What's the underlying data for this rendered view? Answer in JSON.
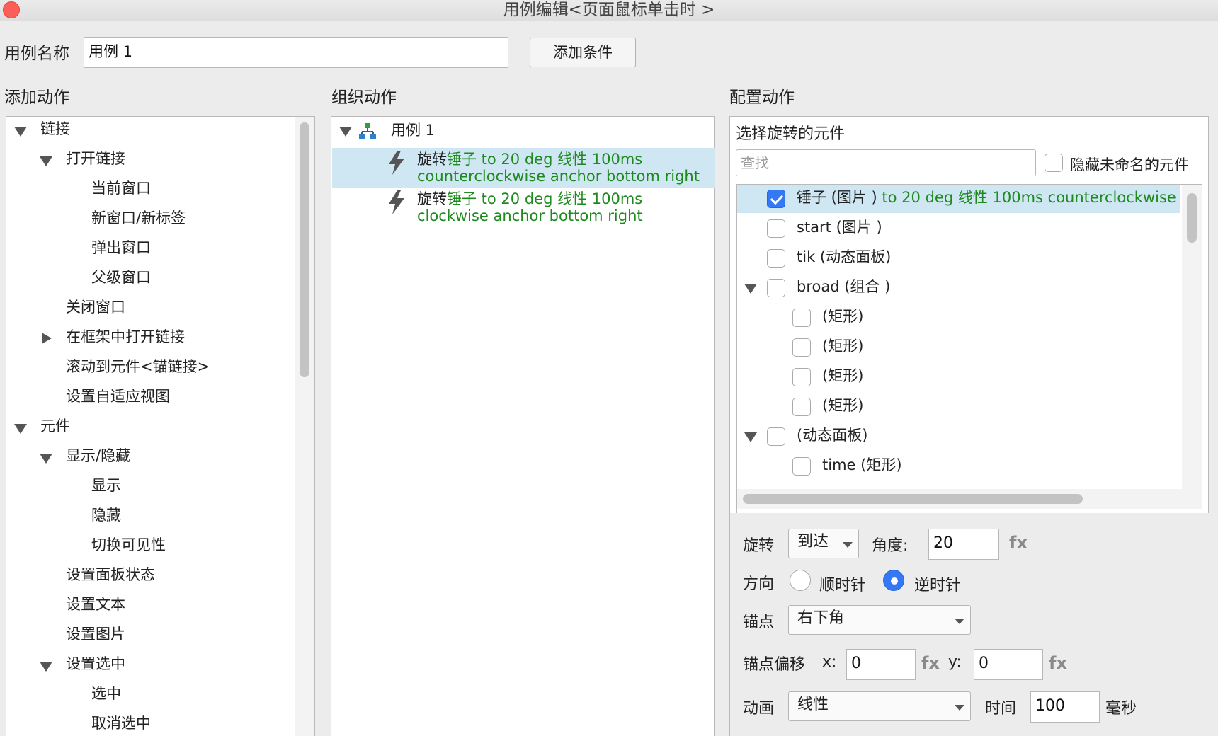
{
  "window": {
    "title": "用例编辑<页面鼠标单击时 >"
  },
  "case_name": {
    "label": "用例名称",
    "value": "用例 1",
    "add_condition": "添加条件"
  },
  "add_actions": {
    "heading": "添加动作",
    "items": [
      {
        "label": "链接"
      },
      {
        "label": "打开链接"
      },
      {
        "label": "当前窗口"
      },
      {
        "label": "新窗口/新标签"
      },
      {
        "label": "弹出窗口"
      },
      {
        "label": "父级窗口"
      },
      {
        "label": "关闭窗口"
      },
      {
        "label": "在框架中打开链接"
      },
      {
        "label": "滚动到元件<锚链接>"
      },
      {
        "label": "设置自适应视图"
      },
      {
        "label": "元件"
      },
      {
        "label": "显示/隐藏"
      },
      {
        "label": "显示"
      },
      {
        "label": "隐藏"
      },
      {
        "label": "切换可见性"
      },
      {
        "label": "设置面板状态"
      },
      {
        "label": "设置文本"
      },
      {
        "label": "设置图片"
      },
      {
        "label": "设置选中"
      },
      {
        "label": "选中"
      },
      {
        "label": "取消选中"
      }
    ]
  },
  "organize": {
    "heading": "组织动作",
    "case_label": "用例 1",
    "actions": [
      {
        "verb": "旋转",
        "target": "锤子 to 20 deg 线性 100ms",
        "detail": "counterclockwise anchor bottom right"
      },
      {
        "verb": "旋转",
        "target": "锤子 to 20 deg 线性 100ms",
        "detail": "clockwise anchor bottom right"
      }
    ]
  },
  "configure": {
    "heading": "配置动作",
    "select_title": "选择旋转的元件",
    "search_placeholder": "查找",
    "hide_unnamed": "隐藏未命名的元件",
    "widgets": [
      {
        "name": "锤子 (图片 )",
        "detail": " to 20 deg 线性 100ms counterclockwise",
        "checked": true
      },
      {
        "name": "start (图片 )",
        "detail": "",
        "checked": false
      },
      {
        "name": "tik (动态面板)",
        "detail": "",
        "checked": false
      },
      {
        "name": "broad (组合 )",
        "detail": "",
        "checked": false
      },
      {
        "name": "(矩形)",
        "detail": "",
        "checked": false
      },
      {
        "name": "(矩形)",
        "detail": "",
        "checked": false
      },
      {
        "name": "(矩形)",
        "detail": "",
        "checked": false
      },
      {
        "name": "(矩形)",
        "detail": "",
        "checked": false
      },
      {
        "name": "(动态面板)",
        "detail": "",
        "checked": false
      },
      {
        "name": "time (矩形)",
        "detail": "",
        "checked": false
      }
    ],
    "rotate_label": "旋转",
    "rotate_mode": "到达",
    "angle_label": "角度:",
    "angle_value": "20",
    "fx": "fx",
    "direction_label": "方向",
    "clockwise": "顺时针",
    "counterclockwise": "逆时针",
    "anchor_label": "锚点",
    "anchor_value": "右下角",
    "offset_label": "锚点偏移",
    "x_label": "x:",
    "x_value": "0",
    "y_label": "y:",
    "y_value": "0",
    "animation_label": "动画",
    "animation_value": "线性",
    "time_label": "时间",
    "time_value": "100",
    "ms_label": "毫秒"
  },
  "colors": {
    "accent": "#3478f6",
    "highlight": "#cfe6f3",
    "green_text": "#1e8a1e"
  }
}
